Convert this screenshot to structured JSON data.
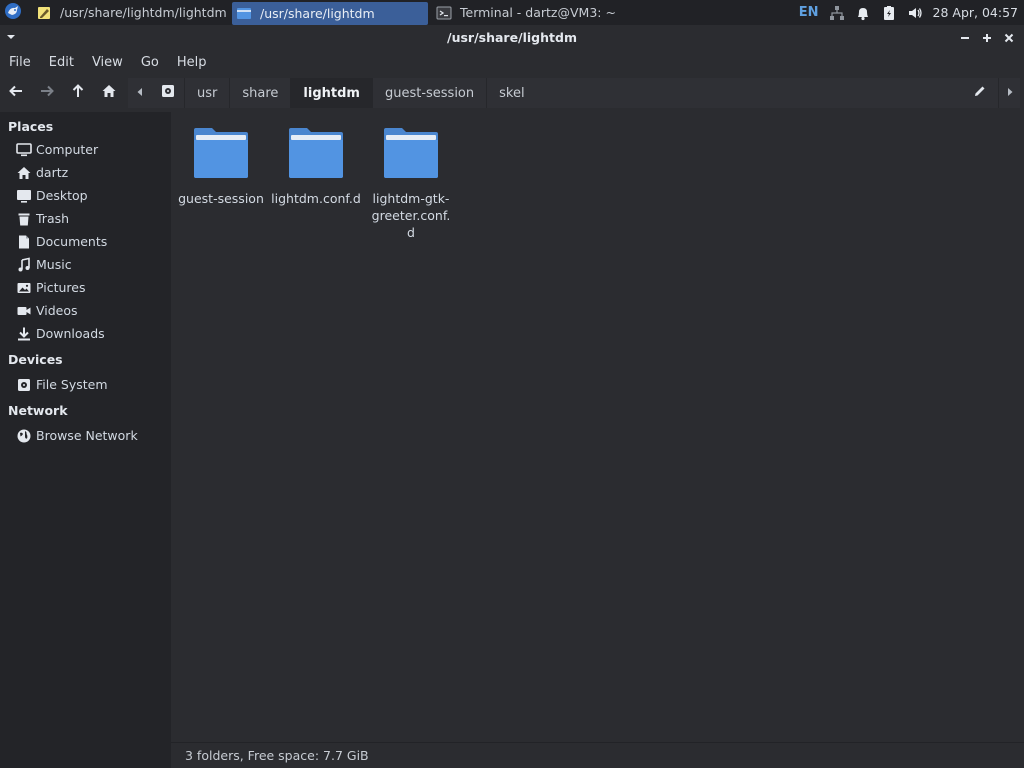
{
  "taskbar": {
    "menu_icon": "xfce-mouse-icon",
    "tasks": [
      {
        "label": "/usr/share/lightdm/lightdm....",
        "icon": "text-editor-icon",
        "active": false
      },
      {
        "label": "/usr/share/lightdm",
        "icon": "folder-icon",
        "active": true
      },
      {
        "label": "Terminal - dartz@VM3: ~",
        "icon": "terminal-icon",
        "active": false
      }
    ],
    "tray": {
      "language": "EN",
      "network_icon": "network-icon",
      "notifications_icon": "bell-icon",
      "power_icon": "battery-icon",
      "volume_icon": "speaker-icon",
      "clock": "28 Apr, 04:57"
    }
  },
  "window": {
    "title": "/usr/share/lightdm",
    "buttons": [
      "minimize",
      "maximize",
      "close"
    ]
  },
  "menubar": [
    "File",
    "Edit",
    "View",
    "Go",
    "Help"
  ],
  "toolbar": {
    "nav": [
      "back-arrow-icon",
      "forward-arrow-icon",
      "up-arrow-icon",
      "home-icon"
    ],
    "breadcrumbs": [
      {
        "label": "usr",
        "current": false
      },
      {
        "label": "share",
        "current": false
      },
      {
        "label": "lightdm",
        "current": true
      },
      {
        "label": "guest-session",
        "current": false
      },
      {
        "label": "skel",
        "current": false
      }
    ]
  },
  "sidebar": {
    "sections": [
      {
        "title": "Places",
        "items": [
          {
            "label": "Computer",
            "icon": "computer-icon"
          },
          {
            "label": "dartz",
            "icon": "home-icon"
          },
          {
            "label": "Desktop",
            "icon": "desktop-icon"
          },
          {
            "label": "Trash",
            "icon": "trash-icon"
          },
          {
            "label": "Documents",
            "icon": "document-icon"
          },
          {
            "label": "Music",
            "icon": "music-icon"
          },
          {
            "label": "Pictures",
            "icon": "pictures-icon"
          },
          {
            "label": "Videos",
            "icon": "video-icon"
          },
          {
            "label": "Downloads",
            "icon": "download-icon"
          }
        ]
      },
      {
        "title": "Devices",
        "items": [
          {
            "label": "File System",
            "icon": "drive-icon"
          }
        ]
      },
      {
        "title": "Network",
        "items": [
          {
            "label": "Browse Network",
            "icon": "globe-icon"
          }
        ]
      }
    ]
  },
  "files": [
    {
      "name": "guest-session",
      "type": "folder"
    },
    {
      "name": "lightdm.conf.d",
      "type": "folder"
    },
    {
      "name": "lightdm-gtk-greeter.conf.d",
      "type": "folder"
    }
  ],
  "status": "3 folders, Free space: 7.7 GiB",
  "colors": {
    "folder": "#5294e2",
    "accent": "#3b5f99",
    "background": "#2b2c30",
    "sidebar": "#232428"
  }
}
